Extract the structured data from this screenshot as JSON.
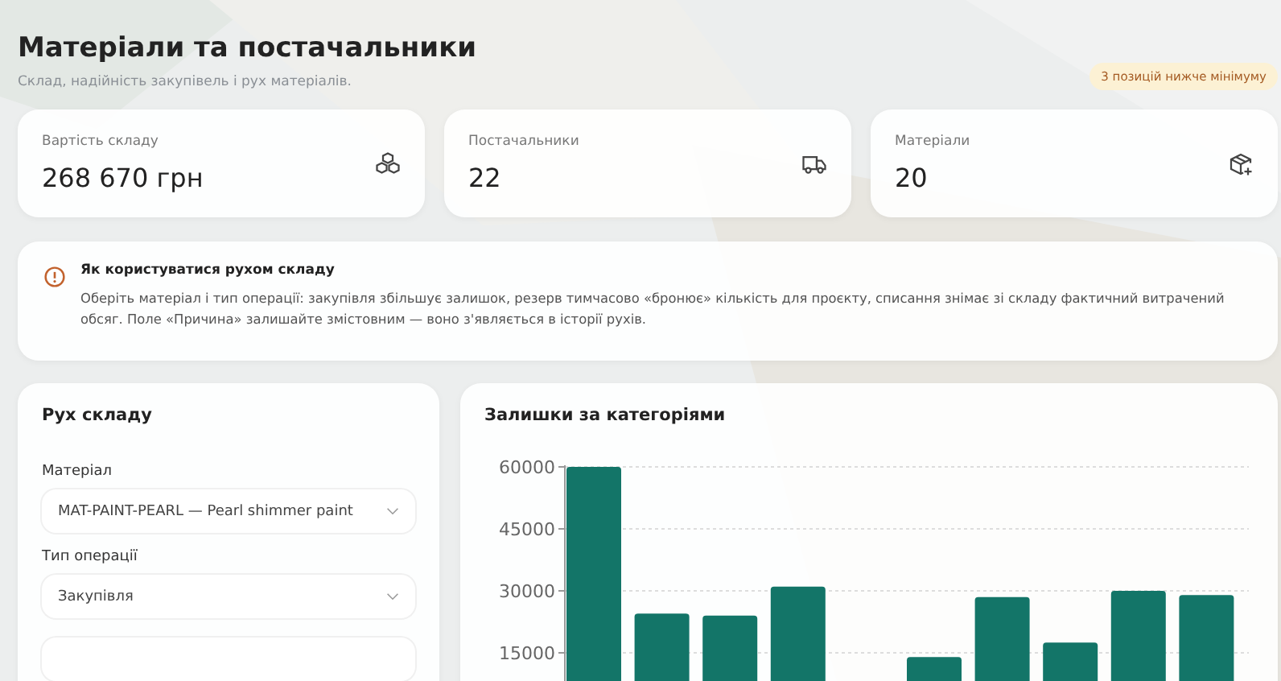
{
  "header": {
    "title": "Матеріали та постачальники",
    "subtitle": "Склад, надійність закупівель і рух матеріалів.",
    "badge": "3 позицій нижче мінімуму"
  },
  "stats": [
    {
      "kind": "value",
      "label": "Вартість складу",
      "value": "268 670 грн"
    },
    {
      "kind": "suppliers",
      "label": "Постачальники",
      "value": "22"
    },
    {
      "kind": "materials",
      "label": "Матеріали",
      "value": "20"
    }
  ],
  "info": {
    "title": "Як користуватися рухом складу",
    "text": "Оберіть матеріал і тип операції: закупівля збільшує залишок, резерв тимчасово «бронює» кількість для проєкту, списання знімає зі складу фактичний витрачений обсяг. Поле «Причина» залишайте змістовним — воно з'являється в історії рухів."
  },
  "movement": {
    "title": "Рух складу",
    "fields": [
      {
        "label": "Матеріал",
        "value": "MAT-PAINT-PEARL — Pearl shimmer paint"
      },
      {
        "label": "Тип операції",
        "value": "Закупівля"
      }
    ]
  },
  "chart": {
    "title": "Залишки за категоріями",
    "chart_data": {
      "type": "bar",
      "values": [
        60000,
        24500,
        24000,
        31000,
        null,
        14000,
        28500,
        17500,
        30000,
        29000
      ],
      "yticks": [
        15000,
        30000,
        45000,
        60000
      ],
      "ylim": [
        0,
        60000
      ],
      "grid": true
    }
  }
}
